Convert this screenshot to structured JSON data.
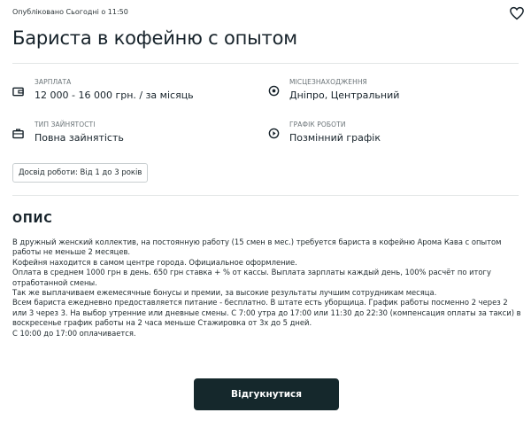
{
  "published": "Опубліковано Сьогодні о 11:50",
  "title": "Бариста в кофейню с опытом",
  "info": {
    "salary": {
      "label": "ЗАРПЛАТА",
      "value": "12 000 - 16 000 грн. / за місяць",
      "icon": "wallet-icon"
    },
    "location": {
      "label": "МІСЦЕЗНАХОДЖЕННЯ",
      "value": "Дніпро, Центральний",
      "icon": "location-pin-icon"
    },
    "employment": {
      "label": "ТИП ЗАЙНЯТОСТІ",
      "value": "Повна зайнятість",
      "icon": "briefcase-icon"
    },
    "schedule": {
      "label": "ГРАФІК РОБОТИ",
      "value": "Позмінний графік",
      "icon": "clock-icon"
    }
  },
  "experience_badge": "Досвід роботи: Від 1 до 3 років",
  "description": {
    "title": "ОПИС",
    "paragraphs": [
      "В дружный женский коллектив, на постоянную работу (15 смен в мес.) требуется бариста в кофейню Арома Кава с опытом работы не меньше 2 месяцев.",
      "Кофейня находится в самом центре города. Официальное оформление.",
      "Оплата в среднем 1000 грн в день. 650 грн ставка + % от кассы. Выплата зарплаты каждый день, 100% расчёт по итогу отработанной смены.",
      "Так же выплачиваем ежемесячные бонусы и премии, за высокие результаты лучшим сотрудникам месяца.",
      "Всем бариста ежедневно предоставляется питание - бесплатно. В штате есть уборщица. График работы посменно 2 через 2 или 3 через 3. На выбор утренние или дневные смены. С 7:00 утра до 17:00 или 11:30 до 22:30 (компенсация оплаты за такси) в воскресенье график работы на 2 часа меньше Стажировка от 3х до 5 дней.",
      "С 10:00 до 17:00 оплачивается."
    ]
  },
  "apply_button": "Відгукнутися",
  "colors": {
    "button_bg": "#15282c",
    "text": "#16222a",
    "muted": "#6b7478"
  }
}
